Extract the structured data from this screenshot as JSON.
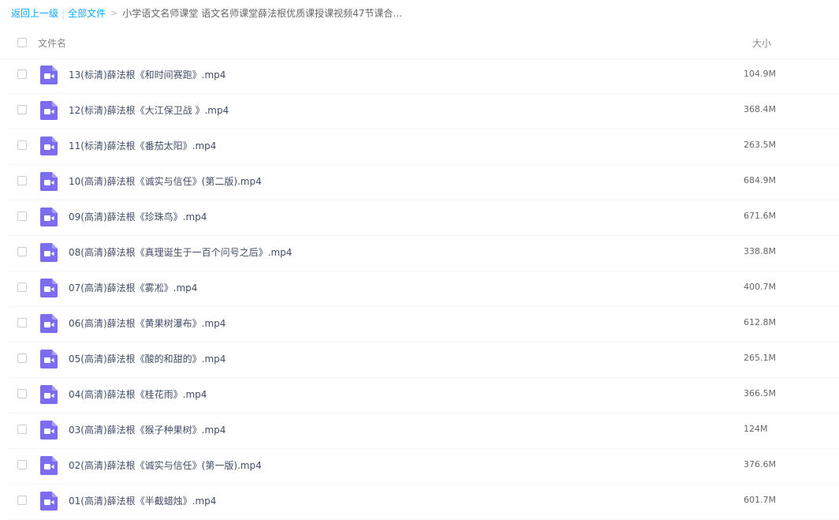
{
  "breadcrumb": {
    "back": "返回上一级",
    "separator": "|",
    "all_files": "全部文件",
    "arrow": ">",
    "current": "小学语文名师课堂 语文名师课堂薛法根优质课授课视频47节课合..."
  },
  "header": {
    "name_label": "文件名",
    "size_label": "大小"
  },
  "icon_color": "#7b6cf0",
  "files": [
    {
      "name": "13(标清)薛法根《和时间赛跑》.mp4",
      "size": "104.9M"
    },
    {
      "name": "12(标清)薛法根《大江保卫战 》.mp4",
      "size": "368.4M"
    },
    {
      "name": "11(标清)薛法根《番茄太阳》.mp4",
      "size": "263.5M"
    },
    {
      "name": "10(高清)薛法根《诚实与信任》(第二版).mp4",
      "size": "684.9M"
    },
    {
      "name": "09(高清)薛法根《珍珠鸟》.mp4",
      "size": "671.6M"
    },
    {
      "name": "08(高清)薛法根《真理诞生于一百个问号之后》.mp4",
      "size": "338.8M"
    },
    {
      "name": "07(高清)薛法根《雾凇》.mp4",
      "size": "400.7M"
    },
    {
      "name": "06(高清)薛法根《黄果树瀑布》.mp4",
      "size": "612.8M"
    },
    {
      "name": "05(高清)薛法根《酸的和甜的》.mp4",
      "size": "265.1M"
    },
    {
      "name": "04(高清)薛法根《桂花雨》.mp4",
      "size": "366.5M"
    },
    {
      "name": "03(高清)薛法根《猴子种果树》.mp4",
      "size": "124M"
    },
    {
      "name": "02(高清)薛法根《诚实与信任》(第一版).mp4",
      "size": "376.6M"
    },
    {
      "name": "01(高清)薛法根《半截蜡烛》.mp4",
      "size": "601.7M"
    }
  ]
}
